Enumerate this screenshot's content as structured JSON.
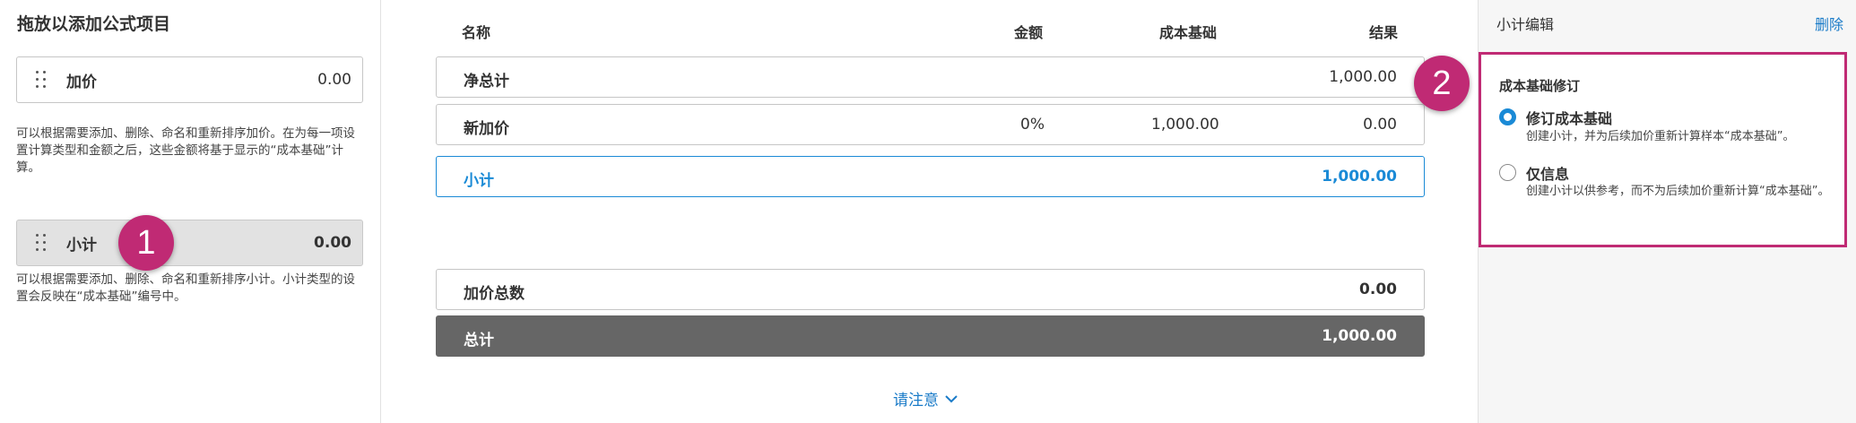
{
  "left": {
    "title": "拖放以添加公式项目",
    "markup_item": {
      "name": "加价",
      "value": "0.00"
    },
    "markup_desc": "可以根据需要添加、删除、命名和重新排序加价。在为每一项设置计算类型和金额之后，这些金额将基于显示的“成本基础”计算。",
    "subtotal_item": {
      "name": "小计",
      "value": "0.00"
    },
    "subtotal_desc": "可以根据需要添加、删除、命名和重新排序小计。小计类型的设置会反映在“成本基础”编号中。"
  },
  "badges": {
    "one": "1",
    "two": "2"
  },
  "table": {
    "headers": {
      "name": "名称",
      "amount": "金额",
      "cost_basis": "成本基础",
      "result": "结果"
    },
    "rows": [
      {
        "name": "净总计",
        "amount": "",
        "cost_basis": "",
        "result": "1,000.00"
      },
      {
        "name": "新加价",
        "amount": "0%",
        "cost_basis": "1,000.00",
        "result": "0.00"
      },
      {
        "name": "小计",
        "amount": "",
        "cost_basis": "",
        "result": "1,000.00"
      }
    ],
    "markup_total": {
      "name": "加价总数",
      "result": "0.00"
    },
    "grand_total": {
      "name": "总计",
      "result": "1,000.00"
    },
    "note_label": "请注意"
  },
  "right": {
    "title": "小计编辑",
    "delete_label": "删除",
    "section_title": "成本基础修订",
    "options": [
      {
        "label": "修订成本基础",
        "desc": "创建小计，并为后续加价重新计算样本“成本基础”。",
        "selected": true
      },
      {
        "label": "仅信息",
        "desc": "创建小计以供参考，而不为后续加价重新计算“成本基础”。",
        "selected": false
      }
    ]
  },
  "colors": {
    "accent": "#1a8ad6",
    "highlight": "#c02a74",
    "total_bar": "#666666"
  }
}
